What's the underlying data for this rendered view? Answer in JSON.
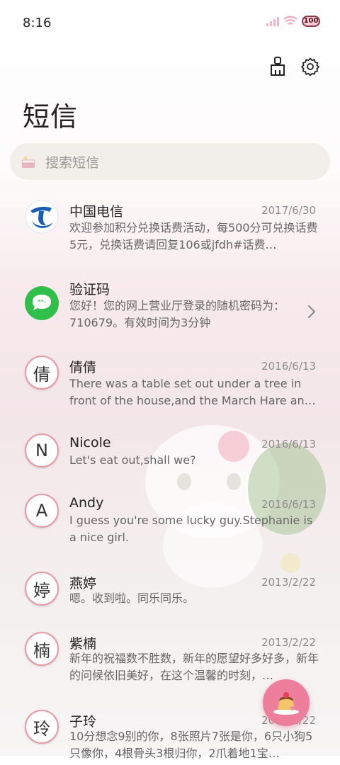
{
  "status_bar": {
    "time": "8:16",
    "battery": "100"
  },
  "header": {
    "title": "短信"
  },
  "search": {
    "placeholder": "搜索短信"
  },
  "icons": {
    "clean": "broom-icon",
    "settings": "gear-icon",
    "search": "cake-icon",
    "fab": "pudding-icon"
  },
  "colors": {
    "accent": "#ee7f9c",
    "avatar_ring": "#e89aa6"
  },
  "messages": [
    {
      "avatar": "",
      "name": "中国电信",
      "date": "2017/6/30",
      "preview": "欢迎参加积分兑换话费活动，每500分可兑换话费5元，兑换话费请回复106或jfdh#话费…"
    },
    {
      "avatar": "",
      "name": "验证码",
      "date": "",
      "preview": "您好！您的网上营业厅登录的随机密码为：710679。有效时间为3分钟"
    },
    {
      "avatar": "倩",
      "name": "倩倩",
      "date": "2016/6/13",
      "preview": "There was a table set out under a tree in front of the house,and the March Hare an…"
    },
    {
      "avatar": "N",
      "name": "Nicole",
      "date": "2016/6/13",
      "preview": "Let's eat out,shall we?"
    },
    {
      "avatar": "A",
      "name": "Andy",
      "date": "2016/6/13",
      "preview": "I guess you're some lucky guy.Stephanie is a nice girl."
    },
    {
      "avatar": "婷",
      "name": "燕婷",
      "date": "2013/2/22",
      "preview": "嗯。收到啦。同乐同乐。"
    },
    {
      "avatar": "楠",
      "name": "紫楠",
      "date": "2013/2/22",
      "preview": "新年的祝福数不胜数，新年的愿望好多好多，新年的问候依旧美好，在这个温馨的时刻，…"
    },
    {
      "avatar": "玲",
      "name": "子玲",
      "date": "2013/2/22",
      "preview": "10分想念9别的你，8张照片7张是你，6只小狗5只像你，4根骨头3根归你，2爪着地1宝…"
    }
  ]
}
